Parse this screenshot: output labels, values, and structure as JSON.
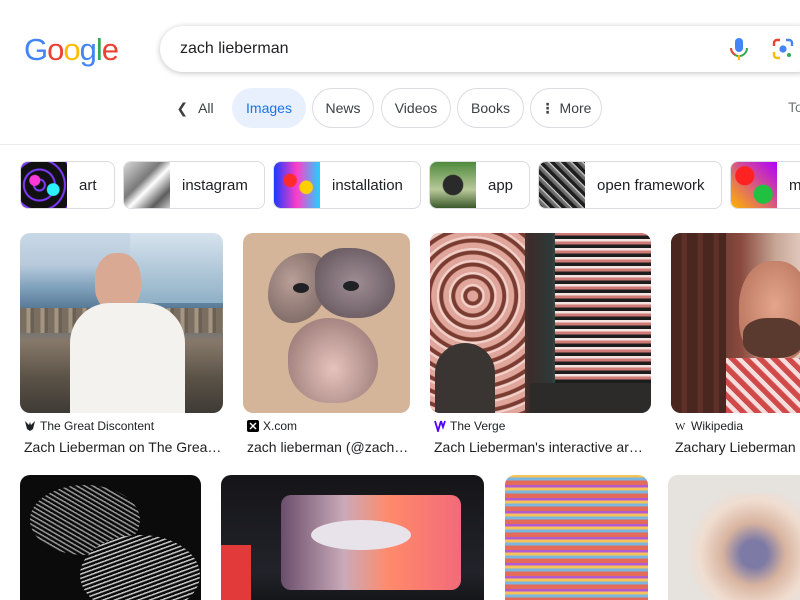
{
  "logo": {
    "text": "Google"
  },
  "search": {
    "query": "zach lieberman"
  },
  "tabs": [
    {
      "label": "All"
    },
    {
      "label": "Images"
    },
    {
      "label": "News"
    },
    {
      "label": "Videos"
    },
    {
      "label": "Books"
    },
    {
      "label": "More"
    }
  ],
  "tools_label": "To",
  "chips": [
    {
      "label": "art"
    },
    {
      "label": "instagram"
    },
    {
      "label": "installation"
    },
    {
      "label": "app"
    },
    {
      "label": "open framework"
    },
    {
      "label": "m"
    }
  ],
  "results": [
    {
      "source": "The Great Discontent",
      "title": "Zach Lieberman on The Grea…"
    },
    {
      "source": "X.com",
      "title": "zach lieberman (@zach…"
    },
    {
      "source": "The Verge",
      "title": "Zach Lieberman's interactive ar…"
    },
    {
      "source": "Wikipedia",
      "title": "Zachary Lieberman"
    }
  ],
  "colors": {
    "accent": "#1a73e8",
    "active_tab_bg": "#e8f0fe",
    "verge_purple": "#5200ff"
  }
}
